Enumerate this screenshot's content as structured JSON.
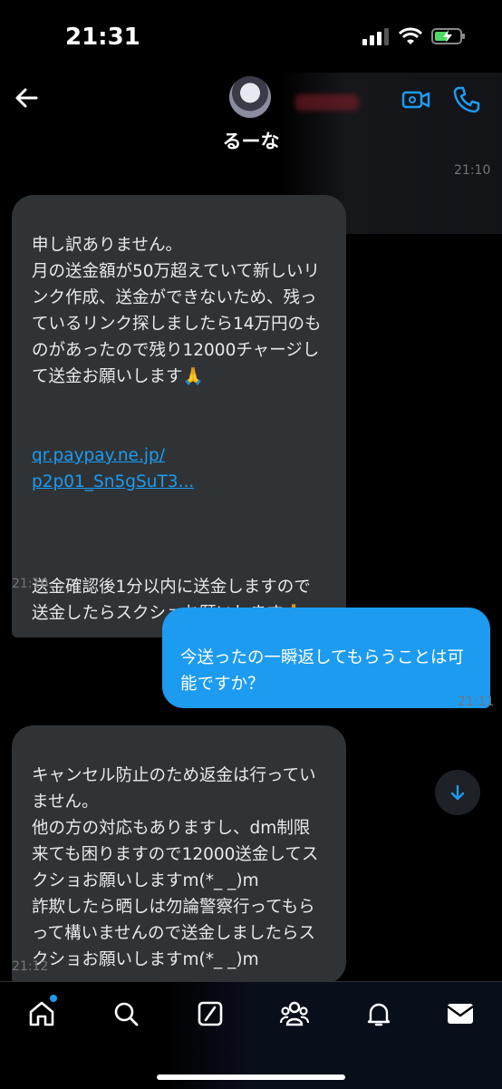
{
  "status_bar": {
    "time": "21:31"
  },
  "header": {
    "contact_name": "るーな"
  },
  "messages": [
    {
      "direction": "incoming",
      "time_above": "21:10",
      "text": "申し訳ありません。\n月の送金額が50万超えていて新しいリンク作成、送金ができないため、残っているリンク探しましたら14万円のものがあったので残り12000チャージして送金お願いします🙏",
      "link": "qr.paypay.ne.jp/\np2p01_Sn5gSuT3...",
      "text_after": "送金確認後1分以内に送金しますので送金したらスクショお願いします🙏",
      "time": "21:10"
    },
    {
      "direction": "outgoing",
      "text": "今送ったの一瞬返してもらうことは可能ですか？",
      "time": "21:11"
    },
    {
      "direction": "incoming",
      "text": "キャンセル防止のため返金は行っていません。\n他の方の対応もありますし、dm制限来ても困りますので12000送金してスクショお願いしますm(*_ _)m\n詐欺したら晒しは勿論警察行ってもらって構いませんので送金しましたらスクショお願いしますm(*_ _)m",
      "time": "21:12"
    }
  ],
  "tab_bar": {
    "tabs": [
      "home",
      "search",
      "grok",
      "communities",
      "notifications",
      "messages"
    ],
    "active": "home"
  },
  "colors": {
    "accent": "#1d9bf0",
    "incoming_bubble": "#2f3336",
    "background": "#000000"
  }
}
